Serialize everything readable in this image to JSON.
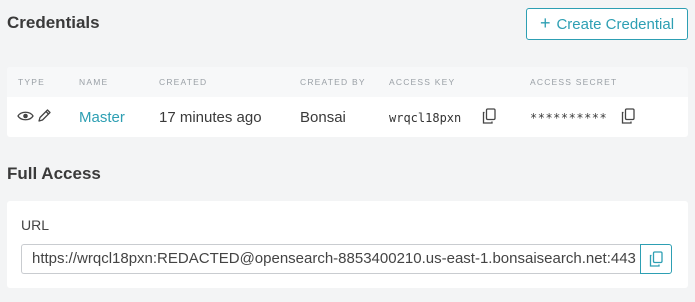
{
  "credentials": {
    "title": "Credentials",
    "create_button_label": "Create Credential",
    "columns": [
      "TYPE",
      "NAME",
      "CREATED",
      "CREATED BY",
      "ACCESS KEY",
      "ACCESS SECRET"
    ],
    "rows": [
      {
        "type_icons": [
          "eye-icon",
          "pencil-icon"
        ],
        "name": "Master",
        "created": "17 minutes ago",
        "created_by": "Bonsai",
        "access_key": "wrqcl18pxn",
        "access_secret": "**********"
      }
    ]
  },
  "full_access": {
    "title": "Full Access",
    "url_label": "URL",
    "url_value": "https://wrqcl18pxn:REDACTED@opensearch-8853400210.us-east-1.bonsaisearch.net:443"
  },
  "colors": {
    "accent": "#2d9fb3",
    "background": "#f3f4f5",
    "card": "#ffffff"
  }
}
